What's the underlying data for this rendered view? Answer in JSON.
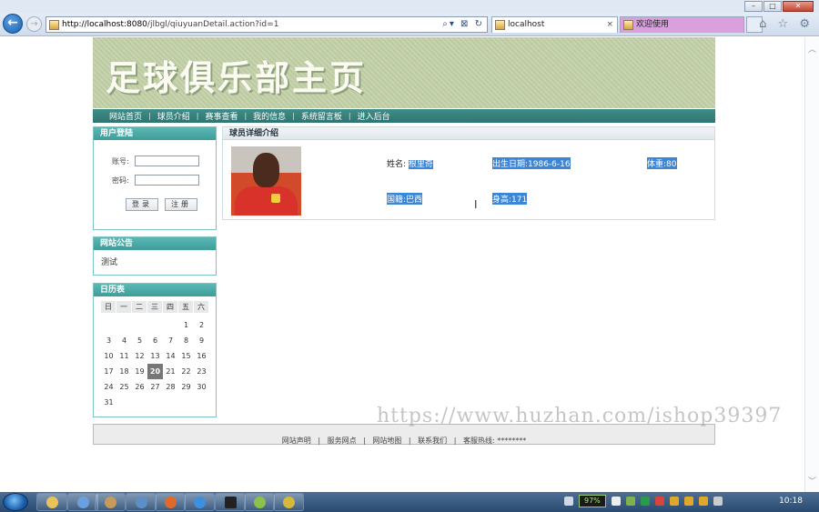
{
  "browser": {
    "address_url_host": "http://localhost:8080",
    "address_url_path": "/jlbgl/qiuyuanDetail.action?id=1",
    "tabs": [
      {
        "label": "localhost",
        "close": "×"
      },
      {
        "label": "欢迎使用"
      }
    ],
    "window_buttons": {
      "minimize": "–",
      "maximize": "□",
      "close": "✕"
    },
    "back_label": "←",
    "forward_label": "→",
    "address_tools": "⌕▾ ⊠ ↻",
    "right_icons": "⌂ ☆ ⚙"
  },
  "site": {
    "banner_title": "足球俱乐部主页",
    "menu": [
      "网站首页",
      "球员介绍",
      "赛事查看",
      "我的信息",
      "系统留言板",
      "进入后台"
    ],
    "menu_separator": "|"
  },
  "login": {
    "title": "用户登陆",
    "account_label": "账号:",
    "password_label": "密码:",
    "login_button": "登录",
    "register_button": "注册"
  },
  "notice": {
    "title": "网站公告",
    "body": "测试"
  },
  "calendar": {
    "title": "日历表",
    "weekdays": [
      "日",
      "一",
      "二",
      "三",
      "四",
      "五",
      "六"
    ],
    "days": [
      "",
      "",
      "",
      "",
      "",
      "1",
      "2",
      "3",
      "4",
      "5",
      "6",
      "7",
      "8",
      "9",
      "10",
      "11",
      "12",
      "13",
      "14",
      "15",
      "16",
      "17",
      "18",
      "19",
      "20",
      "21",
      "22",
      "23",
      "24",
      "25",
      "26",
      "27",
      "28",
      "29",
      "30",
      "31"
    ],
    "today": "20"
  },
  "player": {
    "title": "球员详细介绍",
    "name_label": "姓名:",
    "name_value": "根里奇",
    "birthday": "出生日期:1986-6-16",
    "weight": "体重:80",
    "nationality": "国籍:巴西",
    "height": "身高:171"
  },
  "footer": {
    "links": [
      "网站声明",
      "服务网点",
      "网站地图",
      "联系我们",
      "客服热线: ********"
    ],
    "separator": "|"
  },
  "watermark": "https://www.huzhan.com/ishop39397",
  "taskbar": {
    "battery": "97%",
    "clock": "10:18"
  }
}
